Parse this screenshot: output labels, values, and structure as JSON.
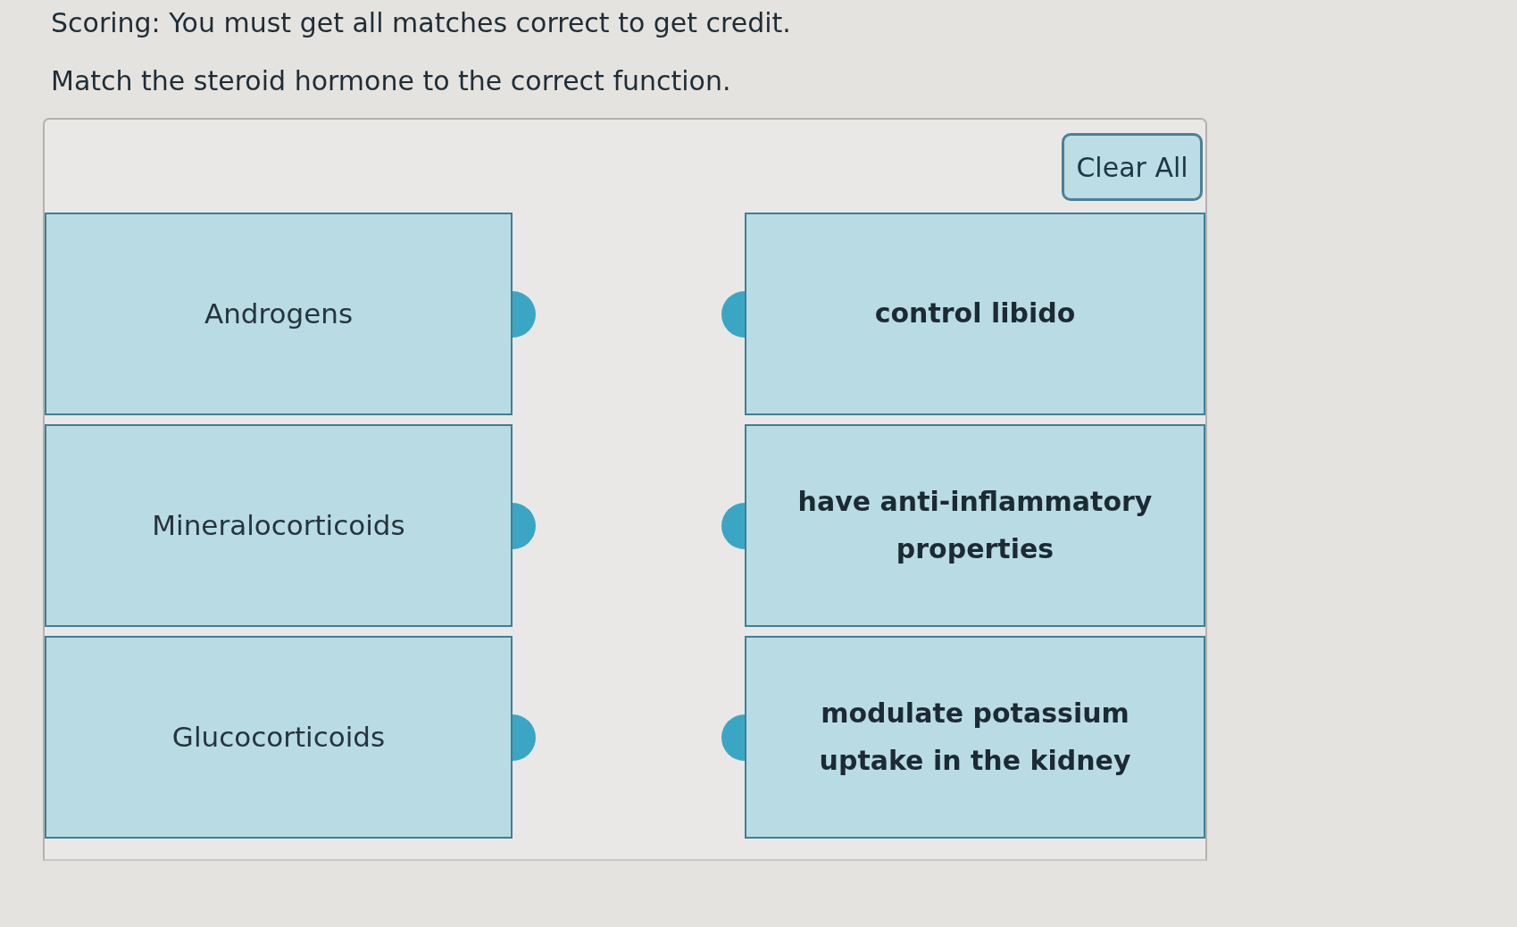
{
  "scoring_note": "Scoring: You must get all matches correct to get credit.",
  "question": "Match the steroid hormone to the correct function.",
  "clear_button": {
    "label": "Clear All"
  },
  "prompts": [
    {
      "label": "Androgens"
    },
    {
      "label": "Mineralocorticoids"
    },
    {
      "label": "Glucocorticoids"
    }
  ],
  "answers": [
    {
      "label": "control libido"
    },
    {
      "label": "have anti-inflammatory properties"
    },
    {
      "label": "modulate potassium uptake in the kidney"
    }
  ]
}
